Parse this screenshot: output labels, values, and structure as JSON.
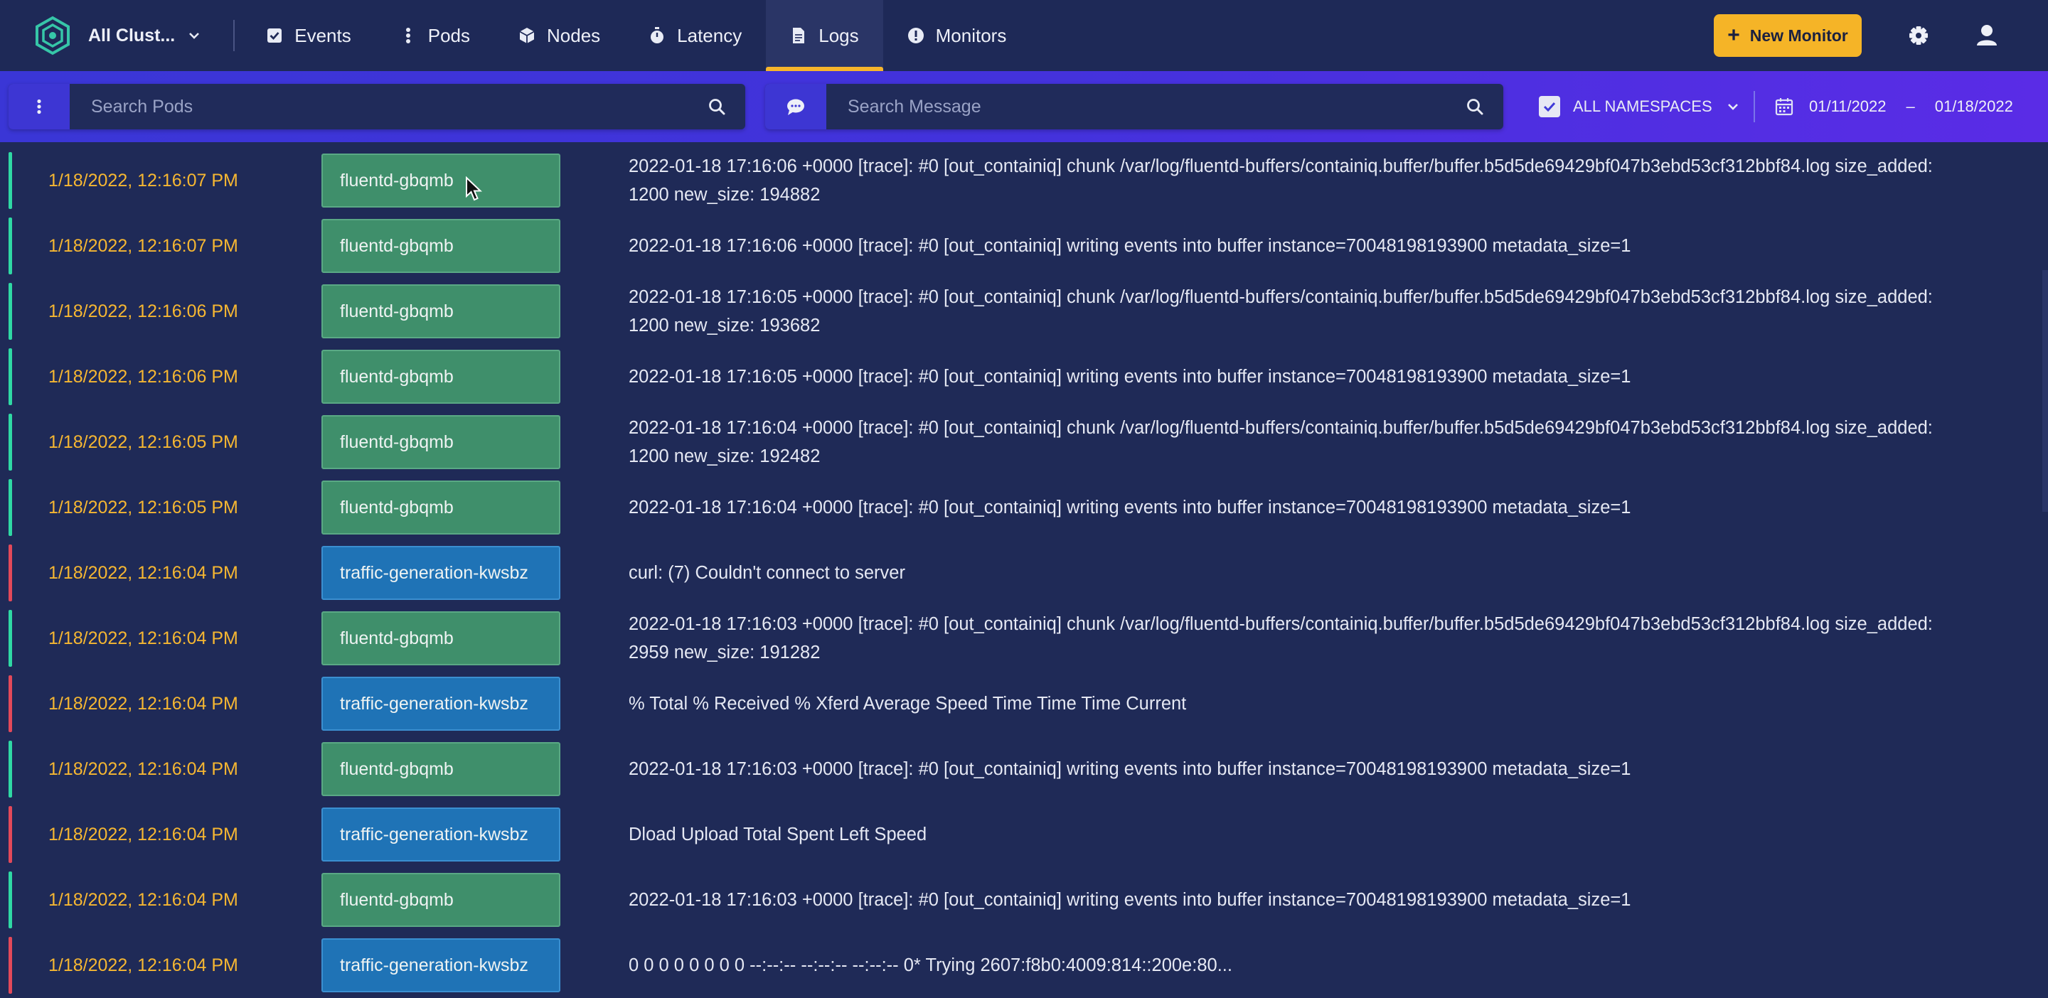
{
  "nav": {
    "cluster_label": "All Clust...",
    "items": [
      {
        "label": "Events",
        "icon": "check-square-icon",
        "active": false
      },
      {
        "label": "Pods",
        "icon": "dots-vertical-icon",
        "active": false
      },
      {
        "label": "Nodes",
        "icon": "cube-icon",
        "active": false
      },
      {
        "label": "Latency",
        "icon": "stopwatch-icon",
        "active": false
      },
      {
        "label": "Logs",
        "icon": "file-icon",
        "active": true
      },
      {
        "label": "Monitors",
        "icon": "alert-circle-icon",
        "active": false
      }
    ],
    "new_monitor_label": "New Monitor"
  },
  "filters": {
    "pods_search_placeholder": "Search Pods",
    "message_search_placeholder": "Search Message",
    "namespace_label": "ALL NAMESPACES",
    "namespace_checked": true,
    "date_from": "01/11/2022",
    "date_separator": "–",
    "date_to": "01/18/2022"
  },
  "colors": {
    "accent": "#f5b427",
    "fluentd_bar": "#2fd8a4",
    "traffic_bar": "#e2495a",
    "fluentd_badge": "#3f8f6b",
    "traffic_badge": "#1f73b6"
  },
  "logs": [
    {
      "timestamp": "1/18/2022, 12:16:07 PM",
      "pod": "fluentd-gbqmb",
      "kind": "fluentd",
      "message": [
        "2022-01-18 17:16:06 +0000 [trace]: #0 [out_containiq] chunk /var/log/fluentd-buffers/containiq.buffer/buffer.b5d5de69429bf047b3ebd53cf312bbf84.log size_added:",
        "1200 new_size: 194882"
      ]
    },
    {
      "timestamp": "1/18/2022, 12:16:07 PM",
      "pod": "fluentd-gbqmb",
      "kind": "fluentd",
      "message": [
        "2022-01-18 17:16:06 +0000 [trace]: #0 [out_containiq] writing events into buffer instance=70048198193900 metadata_size=1"
      ]
    },
    {
      "timestamp": "1/18/2022, 12:16:06 PM",
      "pod": "fluentd-gbqmb",
      "kind": "fluentd",
      "message": [
        "2022-01-18 17:16:05 +0000 [trace]: #0 [out_containiq] chunk /var/log/fluentd-buffers/containiq.buffer/buffer.b5d5de69429bf047b3ebd53cf312bbf84.log size_added:",
        "1200 new_size: 193682"
      ]
    },
    {
      "timestamp": "1/18/2022, 12:16:06 PM",
      "pod": "fluentd-gbqmb",
      "kind": "fluentd",
      "message": [
        "2022-01-18 17:16:05 +0000 [trace]: #0 [out_containiq] writing events into buffer instance=70048198193900 metadata_size=1"
      ]
    },
    {
      "timestamp": "1/18/2022, 12:16:05 PM",
      "pod": "fluentd-gbqmb",
      "kind": "fluentd",
      "message": [
        "2022-01-18 17:16:04 +0000 [trace]: #0 [out_containiq] chunk /var/log/fluentd-buffers/containiq.buffer/buffer.b5d5de69429bf047b3ebd53cf312bbf84.log size_added:",
        "1200 new_size: 192482"
      ]
    },
    {
      "timestamp": "1/18/2022, 12:16:05 PM",
      "pod": "fluentd-gbqmb",
      "kind": "fluentd",
      "message": [
        "2022-01-18 17:16:04 +0000 [trace]: #0 [out_containiq] writing events into buffer instance=70048198193900 metadata_size=1"
      ]
    },
    {
      "timestamp": "1/18/2022, 12:16:04 PM",
      "pod": "traffic-generation-kwsbz",
      "kind": "traffic",
      "message": [
        "curl: (7) Couldn't connect to server"
      ]
    },
    {
      "timestamp": "1/18/2022, 12:16:04 PM",
      "pod": "fluentd-gbqmb",
      "kind": "fluentd",
      "message": [
        "2022-01-18 17:16:03 +0000 [trace]: #0 [out_containiq] chunk /var/log/fluentd-buffers/containiq.buffer/buffer.b5d5de69429bf047b3ebd53cf312bbf84.log size_added:",
        "2959 new_size: 191282"
      ]
    },
    {
      "timestamp": "1/18/2022, 12:16:04 PM",
      "pod": "traffic-generation-kwsbz",
      "kind": "traffic",
      "message": [
        "% Total % Received % Xferd Average Speed Time Time Time Current"
      ]
    },
    {
      "timestamp": "1/18/2022, 12:16:04 PM",
      "pod": "fluentd-gbqmb",
      "kind": "fluentd",
      "message": [
        "2022-01-18 17:16:03 +0000 [trace]: #0 [out_containiq] writing events into buffer instance=70048198193900 metadata_size=1"
      ]
    },
    {
      "timestamp": "1/18/2022, 12:16:04 PM",
      "pod": "traffic-generation-kwsbz",
      "kind": "traffic",
      "message": [
        "Dload Upload Total Spent Left Speed"
      ]
    },
    {
      "timestamp": "1/18/2022, 12:16:04 PM",
      "pod": "fluentd-gbqmb",
      "kind": "fluentd",
      "message": [
        "2022-01-18 17:16:03 +0000 [trace]: #0 [out_containiq] writing events into buffer instance=70048198193900 metadata_size=1"
      ]
    },
    {
      "timestamp": "1/18/2022, 12:16:04 PM",
      "pod": "traffic-generation-kwsbz",
      "kind": "traffic",
      "message": [
        "0 0 0 0 0 0 0 0 --:--:-- --:--:-- --:--:-- 0* Trying 2607:f8b0:4009:814::200e:80..."
      ]
    }
  ]
}
